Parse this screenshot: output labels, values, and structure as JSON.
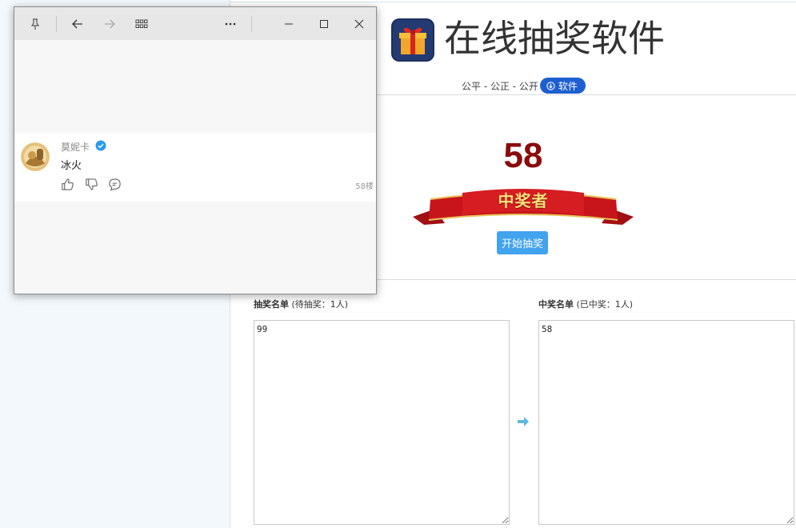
{
  "lottery": {
    "title": "在线抽奖软件",
    "subtitle": "公平 - 公正 - 公开",
    "badge_label": "软件",
    "winner_number": "58",
    "ribbon_text": "中奖者",
    "start_button": "开始抽奖",
    "pending_label": "抽奖名单",
    "pending_count": "(待抽奖：1人)",
    "pending_entries": "99",
    "winners_label": "中奖名单",
    "winners_count": "(已中奖：1人)",
    "winners_entries": "58"
  },
  "popup": {
    "comment": {
      "username": "莫妮卡",
      "text": "冰火",
      "floor": "58楼"
    }
  },
  "colors": {
    "badge": "#1d5fd0",
    "start_button": "#42a3ee",
    "winner_number": "#8a0b0b",
    "ribbon": "#c8151b"
  },
  "icons": {
    "titlebar": [
      "pin-icon",
      "back-arrow-icon",
      "forward-arrow-icon",
      "apps-grid-icon",
      "more-icon",
      "minimize-icon",
      "maximize-icon",
      "close-icon"
    ],
    "comment_actions": [
      "thumbs-up-icon",
      "thumbs-down-icon",
      "reply-bubble-icon"
    ]
  }
}
